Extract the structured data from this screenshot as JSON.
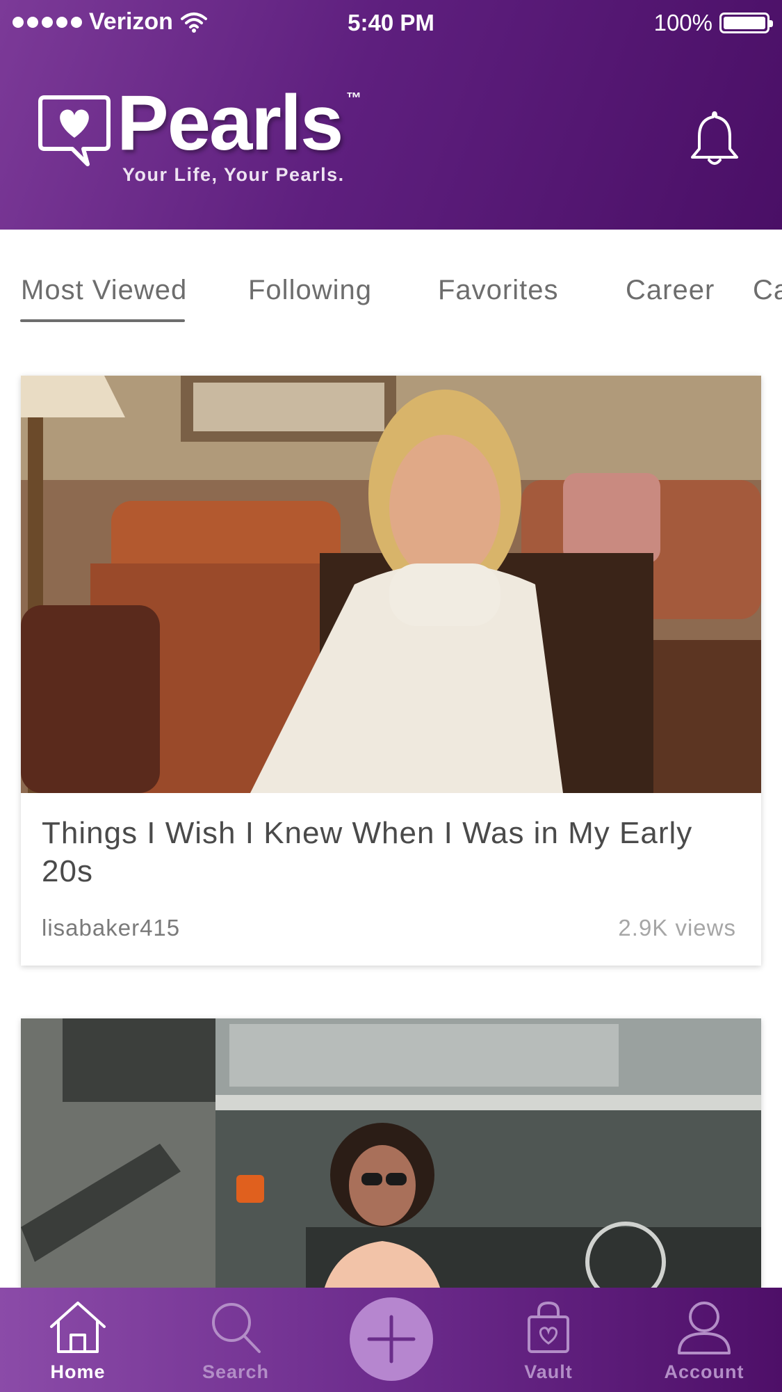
{
  "status_bar": {
    "carrier": "Verizon",
    "time": "5:40 PM",
    "battery": "100%"
  },
  "header": {
    "app_name": "Pearls",
    "trademark": "™",
    "tagline": "Your Life, Your Pearls.",
    "notification_icon": "bell-icon"
  },
  "tabs": [
    {
      "label": "Most Viewed",
      "active": true
    },
    {
      "label": "Following",
      "active": false
    },
    {
      "label": "Favorites",
      "active": false
    },
    {
      "label": "Career",
      "active": false
    },
    {
      "label": "Ca",
      "active": false
    }
  ],
  "feed": [
    {
      "title": "Things I Wish I Knew When I Was in My Early 20s",
      "author": "lisabaker415",
      "views": "2.9K views"
    },
    {
      "title": "",
      "author": "",
      "views": ""
    }
  ],
  "bottom_nav": {
    "home": "Home",
    "search": "Search",
    "add_icon": "plus-icon",
    "vault": "Vault",
    "account": "Account"
  },
  "colors": {
    "brand_purple": "#5e1f7e",
    "active_nav": "#ffffff",
    "inactive_nav": "#b38ec7",
    "add_button": "#b686cf"
  }
}
